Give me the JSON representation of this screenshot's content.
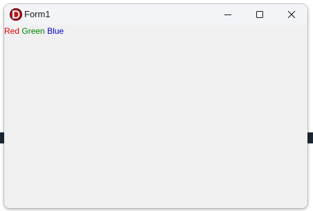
{
  "window": {
    "title": "Form1",
    "app_icon": "delphi-logo-icon",
    "caption_buttons": [
      "minimize-icon",
      "maximize-icon",
      "close-icon"
    ]
  },
  "client": {
    "labels": [
      {
        "text": "Red",
        "color": "#e00000"
      },
      {
        "text": "Green",
        "color": "#008000"
      },
      {
        "text": "Blue",
        "color": "#0000d0"
      }
    ]
  }
}
